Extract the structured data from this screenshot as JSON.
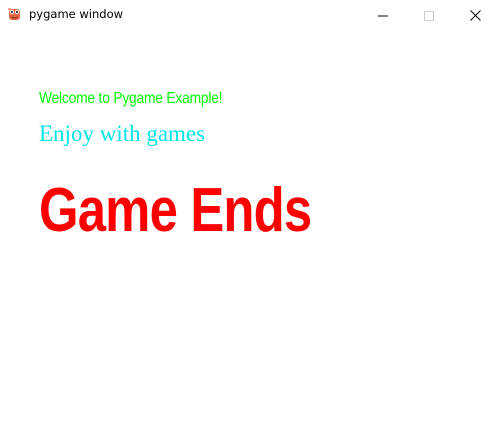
{
  "window": {
    "title": "pygame window",
    "controls": {
      "minimize_icon": "minimize-icon",
      "maximize_icon": "maximize-icon",
      "close_icon": "close-icon"
    }
  },
  "canvas": {
    "welcome_text": "Welcome to Pygame Example!",
    "enjoy_text": "Enjoy with games",
    "game_ends_text": "Game Ends"
  },
  "colors": {
    "welcome": "#00ff00",
    "enjoy": "#00e6e6",
    "game_ends": "#ff0000",
    "background": "#ffffff"
  }
}
